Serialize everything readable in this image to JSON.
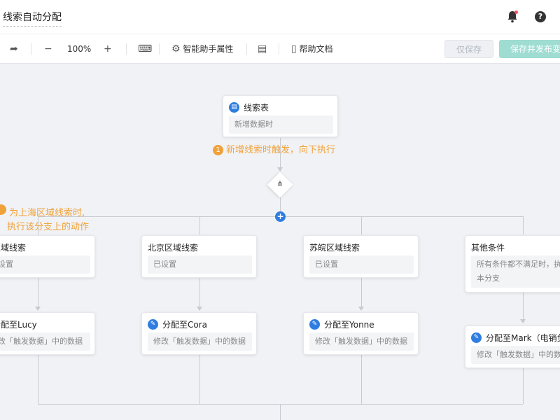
{
  "header": {
    "title": "线索自动分配"
  },
  "toolbar": {
    "zoom": "100%",
    "assistant_props": "智能助手属性",
    "help_docs": "帮助文档",
    "save_only": "仅保存",
    "save_publish": "保存并发布变"
  },
  "trigger": {
    "name": "线索表",
    "desc": "新增数据时",
    "annotation_num": "1",
    "annotation": "新增线索时触发，向下执行"
  },
  "branch_annotation": {
    "line1": "为上海区域线索时,",
    "line2": "执行该分支上的动作"
  },
  "branches": [
    {
      "name": "区域线索",
      "desc": "设置",
      "action": "分配至Lucy",
      "action_desc": "改「触发数据」中的数据"
    },
    {
      "name": "北京区域线索",
      "desc": "已设置",
      "action": "分配至Cora",
      "action_desc": "修改「触发数据」中的数据"
    },
    {
      "name": "苏皖区域线索",
      "desc": "已设置",
      "action": "分配至Yonne",
      "action_desc": "修改「触发数据」中的数据"
    },
    {
      "name": "其他条件",
      "desc_line1": "所有条件都不满足时，执",
      "desc_line2": "本分支",
      "action": "分配至Mark（电销负",
      "action_desc": "修改「触发数据」中的数据"
    }
  ]
}
